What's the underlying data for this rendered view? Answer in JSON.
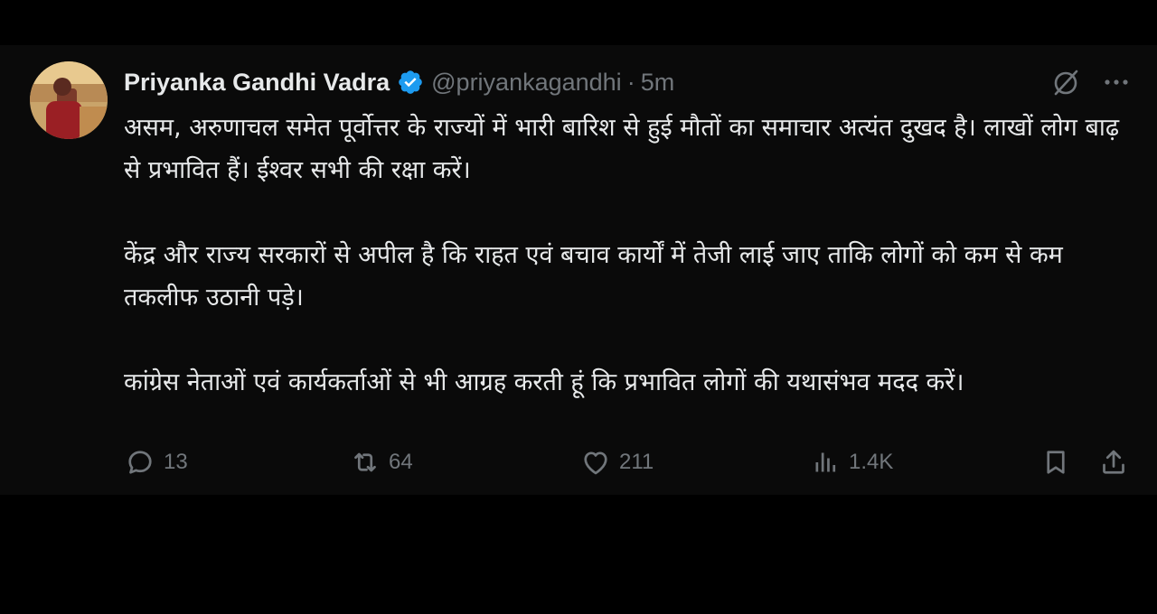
{
  "tweet": {
    "author_name": "Priyanka Gandhi Vadra",
    "handle": "@priyankagandhi",
    "separator": "·",
    "time": "5m",
    "paragraphs": [
      "असम, अरुणाचल समेत पूर्वोत्तर के राज्यों में भारी बारिश से हुई मौतों का समाचार अत्यंत दुखद है। लाखों लोग बाढ़ से प्रभावित हैं। ईश्वर सभी की रक्षा करें।",
      "केंद्र और राज्य सरकारों से अपील है कि राहत एवं बचाव कार्यों में तेजी लाई जाए ताकि लोगों को कम से कम तकलीफ उठानी पड़े।",
      "कांग्रेस नेताओं एवं कार्यकर्ताओं से भी आग्रह करती हूं कि प्रभावित लोगों की यथासंभव मदद करें।"
    ]
  },
  "actions": {
    "replies": "13",
    "reposts": "64",
    "likes": "211",
    "views": "1.4K"
  },
  "icons": {
    "verified": "verified-badge-icon",
    "grok": "grok-icon",
    "more": "more-icon",
    "reply": "reply-icon",
    "repost": "repost-icon",
    "like": "like-icon",
    "views": "views-icon",
    "bookmark": "bookmark-icon",
    "share": "share-icon"
  },
  "colors": {
    "background": "#000000",
    "text": "#e7e9ea",
    "muted": "#71767b",
    "verified": "#1d9bf0"
  }
}
